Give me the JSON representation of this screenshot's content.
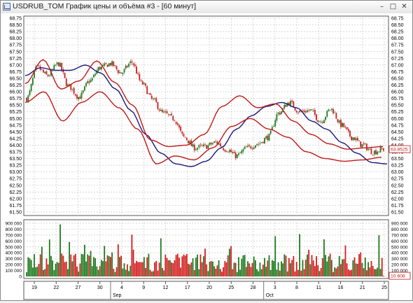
{
  "window": {
    "title": "USDRUB_TOM График цены и объёма #3 - [60 минут]",
    "minimize_glyph": "–",
    "maximize_glyph": "□",
    "close_glyph": "✕"
  },
  "chart_data": [
    {
      "type": "candlestick",
      "instrument": "USDRUB_TOM",
      "timeframe": "60 минут",
      "ylim": [
        61.5,
        68.75
      ],
      "y_ticks": [
        "68.75",
        "68.50",
        "68.25",
        "68.00",
        "67.75",
        "67.50",
        "67.25",
        "67.00",
        "66.75",
        "66.50",
        "66.25",
        "66.00",
        "65.75",
        "65.50",
        "65.25",
        "65.00",
        "64.75",
        "64.50",
        "64.25",
        "64.00",
        "63.75",
        "63.50",
        "63.25",
        "63.00",
        "62.75",
        "62.50",
        "62.25",
        "62.00",
        "61.75",
        "61.50"
      ],
      "x_ticks": [
        "19",
        "22",
        "27",
        "30",
        "4",
        "9",
        "12",
        "17",
        "20",
        "25",
        "28",
        "3",
        "8",
        "11",
        "16",
        "21",
        "25"
      ],
      "month_labels": [
        {
          "label": "Sep",
          "at_tick": 4
        },
        {
          "label": "Oct",
          "at_tick": 11
        }
      ],
      "last_price": "63.8525",
      "grid": true,
      "close_series": [
        65.75,
        66.9,
        66.6,
        67.05,
        66.2,
        65.8,
        66.4,
        66.9,
        67.05,
        66.7,
        67.1,
        66.3,
        65.7,
        65.2,
        65.0,
        64.3,
        63.9,
        63.95,
        64.1,
        63.85,
        63.6,
        63.9,
        64.05,
        64.3,
        65.2,
        65.6,
        65.25,
        65.3,
        64.9,
        65.35,
        64.75,
        64.3,
        64.0,
        63.75,
        63.85
      ],
      "envelopes": {
        "blue": [
          66.6,
          66.9,
          66.8,
          66.8,
          67.0,
          66.7,
          66.1,
          65.3,
          64.4,
          63.7,
          63.3,
          63.2,
          63.4,
          63.9,
          64.6,
          65.1,
          65.45,
          65.6,
          65.4,
          64.9,
          64.6,
          64.1,
          63.7,
          63.35,
          63.3
        ],
        "red_upper": [
          66.3,
          67.2,
          66.1,
          66.4,
          67.15,
          66.35,
          65.5,
          64.2,
          63.95,
          64.0,
          64.4,
          65.45,
          65.85,
          65.4,
          65.55,
          64.9,
          64.4,
          64.05,
          63.85,
          63.9,
          63.95
        ],
        "red_lower": [
          65.6,
          66.0,
          64.9,
          65.6,
          66.0,
          65.4,
          64.6,
          63.3,
          63.6,
          63.45,
          63.9,
          64.7,
          65.0,
          64.6,
          64.3,
          63.75,
          63.5,
          63.4,
          63.45,
          63.55
        ]
      }
    },
    {
      "type": "bar",
      "name": "volume",
      "ylim": [
        0,
        900000
      ],
      "y_ticks": [
        "900 000",
        "800 000",
        "700 000",
        "600 000",
        "500 000",
        "400 000",
        "300 000",
        "200 000",
        "100 000",
        "0"
      ],
      "last_volume": "10 608",
      "bar_count": 235,
      "peak_volume": 880000,
      "colors": {
        "up": "#1e7a1e",
        "down": "#d41e1e"
      }
    }
  ]
}
